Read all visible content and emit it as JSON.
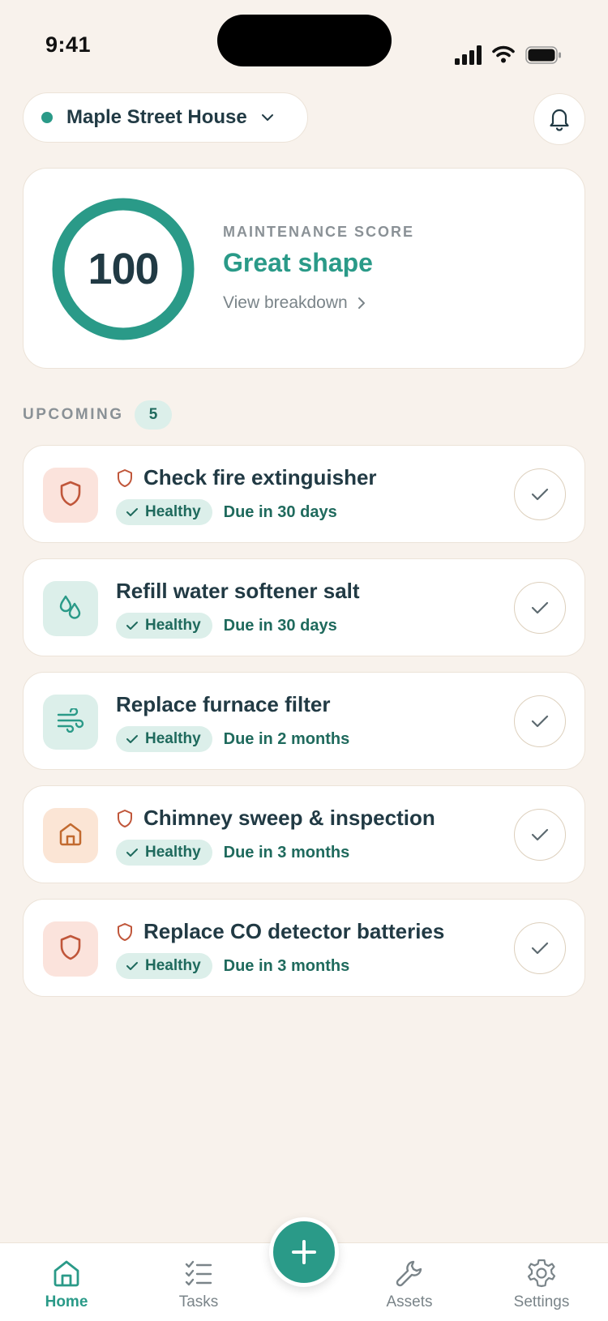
{
  "status_bar": {
    "time": "9:41"
  },
  "header": {
    "home_name": "Maple Street House",
    "home_status_color": "#2a9a88"
  },
  "score_card": {
    "score": "100",
    "score_fraction": 1.0,
    "label": "MAINTENANCE SCORE",
    "status": "Great shape",
    "breakdown_link": "View breakdown"
  },
  "upcoming": {
    "label": "UPCOMING",
    "count": "5",
    "tasks": [
      {
        "title": "Check fire extinguisher",
        "icon": "shield-icon",
        "icon_color": "red",
        "safety": true,
        "health": "Healthy",
        "due": "Due in 30 days"
      },
      {
        "title": "Refill water softener salt",
        "icon": "droplets-icon",
        "icon_color": "teal",
        "safety": false,
        "health": "Healthy",
        "due": "Due in 30 days"
      },
      {
        "title": "Replace furnace filter",
        "icon": "wind-icon",
        "icon_color": "teal",
        "safety": false,
        "health": "Healthy",
        "due": "Due in 2 months"
      },
      {
        "title": "Chimney sweep & inspection",
        "icon": "house-icon",
        "icon_color": "orange",
        "safety": true,
        "health": "Healthy",
        "due": "Due in 3 months"
      },
      {
        "title": "Replace CO detector batteries",
        "icon": "shield-icon",
        "icon_color": "red",
        "safety": true,
        "health": "Healthy",
        "due": "Due in 3 months"
      }
    ]
  },
  "nav": {
    "home": "Home",
    "tasks": "Tasks",
    "assets": "Assets",
    "settings": "Settings",
    "active": "home"
  },
  "colors": {
    "accent": "#2a9a88",
    "background": "#f8f2ec",
    "text": "#213a44",
    "safety_red": "#c0563a",
    "orange": "#c26a2f"
  }
}
